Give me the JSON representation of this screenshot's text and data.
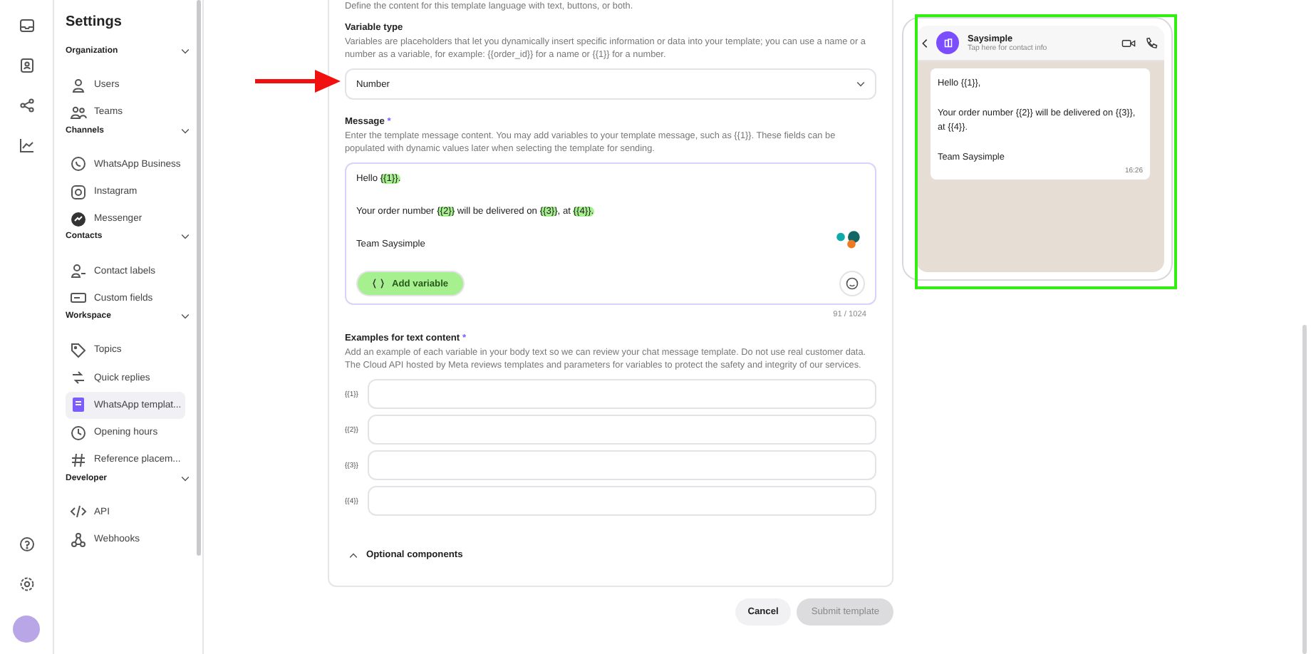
{
  "sidebar": {
    "title": "Settings",
    "sections": [
      {
        "title": "Organization",
        "expanded": true,
        "items": [
          {
            "label": "Users",
            "selected": false
          },
          {
            "label": "Teams",
            "selected": false
          }
        ]
      },
      {
        "title": "Channels",
        "expanded": true,
        "items": [
          {
            "label": "WhatsApp Business",
            "selected": false
          },
          {
            "label": "Instagram",
            "selected": false
          },
          {
            "label": "Messenger",
            "selected": false
          }
        ]
      },
      {
        "title": "Contacts",
        "expanded": true,
        "items": [
          {
            "label": "Contact labels",
            "selected": false
          },
          {
            "label": "Custom fields",
            "selected": false
          }
        ]
      },
      {
        "title": "Workspace",
        "expanded": true,
        "items": [
          {
            "label": "Topics",
            "selected": false
          },
          {
            "label": "Quick replies",
            "selected": false
          },
          {
            "label": "WhatsApp templat...",
            "selected": true
          },
          {
            "label": "Opening hours",
            "selected": false
          },
          {
            "label": "Reference placem...",
            "selected": false
          }
        ]
      },
      {
        "title": "Developer",
        "expanded": true,
        "items": [
          {
            "label": "API",
            "selected": false
          },
          {
            "label": "Webhooks",
            "selected": false
          }
        ]
      }
    ]
  },
  "form": {
    "intro": "Define the content for this template language with text, buttons, or both.",
    "variable_type": {
      "label": "Variable type",
      "description": "Variables are placeholders that let you dynamically insert specific information or data into your template; you can use a name or a number as a variable, for example: {{order_id}} for a name or {{1}} for a number.",
      "value": "Number"
    },
    "message": {
      "label": "Message",
      "required_mark": "*",
      "description": "Enter the template message content. You may add variables to your template message, such as {{1}}. These fields can be populated with dynamic values later when selecting the template for sending.",
      "lines": [
        [
          {
            "text": "Hello ",
            "highlighted": false
          },
          {
            "text": "{{1}}.",
            "highlighted": true
          }
        ],
        [
          {
            "text": "Your order number ",
            "highlighted": false
          },
          {
            "text": "{{2}}",
            "highlighted": true
          },
          {
            "text": " will be delivered on ",
            "highlighted": false
          },
          {
            "text": "{{3}}",
            "highlighted": true
          },
          {
            "text": ", at ",
            "highlighted": false
          },
          {
            "text": "{{4}}.",
            "highlighted": true
          }
        ],
        [
          {
            "text": "Team Saysimple",
            "highlighted": false
          }
        ]
      ],
      "add_variable": "Add variable",
      "add_variable_highlighted": true,
      "counter": "91 / 1024"
    },
    "examples": {
      "label": "Examples for text content",
      "required_mark": "*",
      "description": "Add an example of each variable in your body text so we can review your chat message template. Do not use real customer data. The Cloud API hosted by Meta reviews templates and parameters for variables to protect the safety and integrity of our services.",
      "fields": [
        {
          "label": "{{1}}"
        },
        {
          "label": "{{2}}"
        },
        {
          "label": "{{3}}"
        },
        {
          "label": "{{4}}"
        }
      ]
    },
    "optional": {
      "label": "Optional components",
      "expanded": false
    }
  },
  "buttons": [
    {
      "label": "Cancel",
      "disabled": false
    },
    {
      "label": "Submit template",
      "disabled": true
    }
  ],
  "preview": {
    "name": "Saysimple",
    "subtitle": "Tap here for contact info",
    "bubble": [
      "Hello {{1}},",
      "Your order number {{2}} will be delivered on {{3}}, at {{4}}.",
      "Team Saysimple"
    ],
    "time": "16:26"
  }
}
